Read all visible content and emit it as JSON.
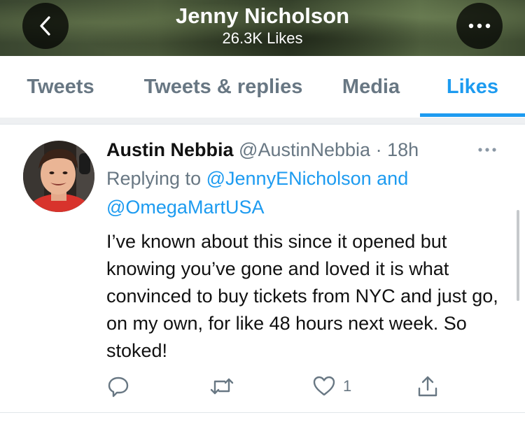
{
  "header": {
    "title": "Jenny Nicholson",
    "subtitle": "26.3K Likes",
    "back_icon": "chevron-left-icon",
    "more_icon": "ellipsis-icon"
  },
  "tabs": [
    {
      "label": "Tweets",
      "active": false
    },
    {
      "label": "Tweets & replies",
      "active": false
    },
    {
      "label": "Media",
      "active": false
    },
    {
      "label": "Likes",
      "active": true
    }
  ],
  "tweet": {
    "author_name": "Austin Nebbia",
    "author_handle": "@AustinNebbia",
    "separator": "·",
    "time": "18h",
    "replying_prefix": "Replying to",
    "reply_mentions": [
      "@JennyENicholson",
      "@OmegaMartUSA"
    ],
    "reply_conjunction": "and",
    "text": "I’ve known about this since it opened but knowing you’ve gone and loved it is what convinced to buy tickets from NYC and just go, on my own, for like 48 hours next week. So stoked!",
    "actions": {
      "reply_icon": "reply-icon",
      "retweet_icon": "retweet-icon",
      "like_icon": "heart-icon",
      "like_count": "1",
      "share_icon": "share-icon"
    }
  },
  "colors": {
    "accent": "#1d9bf0",
    "secondary_text": "#687783",
    "primary_text": "#111111"
  }
}
